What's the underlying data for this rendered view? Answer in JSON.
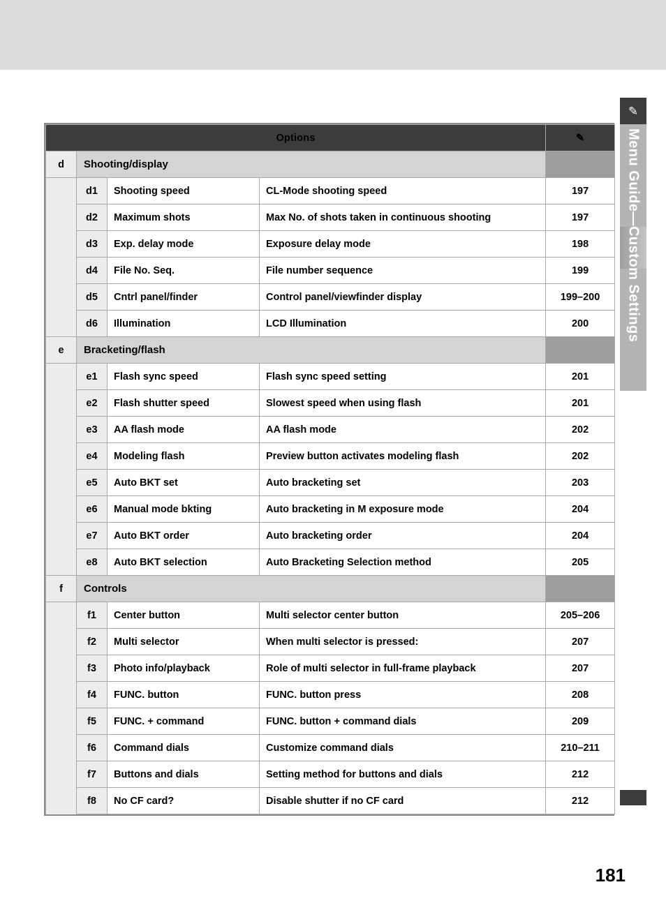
{
  "page": {
    "number": "181",
    "side_tab_label": "Menu Guide—Custom Settings",
    "side_tab_icon": "pencil-icon"
  },
  "table": {
    "header": {
      "options_label": "Options",
      "icon": "pencil-icon"
    },
    "columns": [
      "letter",
      "code",
      "name",
      "description",
      "page"
    ],
    "groups": [
      {
        "letter": "d",
        "title": "Shooting/display",
        "rows": [
          {
            "code": "d1",
            "name": "Shooting speed",
            "desc": "CL-Mode shooting speed",
            "page": "197"
          },
          {
            "code": "d2",
            "name": "Maximum shots",
            "desc": "Max No. of shots taken in continuous shooting",
            "page": "197"
          },
          {
            "code": "d3",
            "name": "Exp. delay mode",
            "desc": "Exposure delay mode",
            "page": "198"
          },
          {
            "code": "d4",
            "name": "File No. Seq.",
            "desc": "File number sequence",
            "page": "199"
          },
          {
            "code": "d5",
            "name": "Cntrl panel/finder",
            "desc": "Control panel/viewfinder display",
            "page": "199–200"
          },
          {
            "code": "d6",
            "name": "Illumination",
            "desc": "LCD Illumination",
            "page": "200"
          }
        ]
      },
      {
        "letter": "e",
        "title": "Bracketing/flash",
        "rows": [
          {
            "code": "e1",
            "name": "Flash sync speed",
            "desc": "Flash sync speed setting",
            "page": "201"
          },
          {
            "code": "e2",
            "name": "Flash shutter speed",
            "desc": "Slowest speed when using flash",
            "page": "201"
          },
          {
            "code": "e3",
            "name": "AA flash mode",
            "desc": "AA flash mode",
            "page": "202"
          },
          {
            "code": "e4",
            "name": "Modeling flash",
            "desc": "Preview button activates modeling flash",
            "page": "202"
          },
          {
            "code": "e5",
            "name": "Auto BKT set",
            "desc": "Auto bracketing set",
            "page": "203"
          },
          {
            "code": "e6",
            "name": "Manual mode bkting",
            "desc": "Auto bracketing in M exposure mode",
            "page": "204"
          },
          {
            "code": "e7",
            "name": "Auto BKT order",
            "desc": "Auto bracketing order",
            "page": "204"
          },
          {
            "code": "e8",
            "name": "Auto BKT selection",
            "desc": "Auto Bracketing Selection method",
            "page": "205"
          }
        ]
      },
      {
        "letter": "f",
        "title": "Controls",
        "rows": [
          {
            "code": "f1",
            "name": "Center button",
            "desc": "Multi selector center button",
            "page": "205–206"
          },
          {
            "code": "f2",
            "name": "Multi selector",
            "desc": "When multi selector is pressed:",
            "page": "207"
          },
          {
            "code": "f3",
            "name": "Photo info/playback",
            "desc": "Role of multi selector in full-frame playback",
            "page": "207"
          },
          {
            "code": "f4",
            "name": "FUNC. button",
            "desc": "FUNC. button press",
            "page": "208"
          },
          {
            "code": "f5",
            "name": "FUNC. + command",
            "desc": "FUNC. button + command dials",
            "page": "209"
          },
          {
            "code": "f6",
            "name": "Command dials",
            "desc": "Customize command dials",
            "page": "210–211"
          },
          {
            "code": "f7",
            "name": "Buttons and dials",
            "desc": "Setting method for buttons and dials",
            "page": "212"
          },
          {
            "code": "f8",
            "name": "No CF card?",
            "desc": "Disable shutter if no CF card",
            "page": "212"
          }
        ]
      }
    ]
  }
}
